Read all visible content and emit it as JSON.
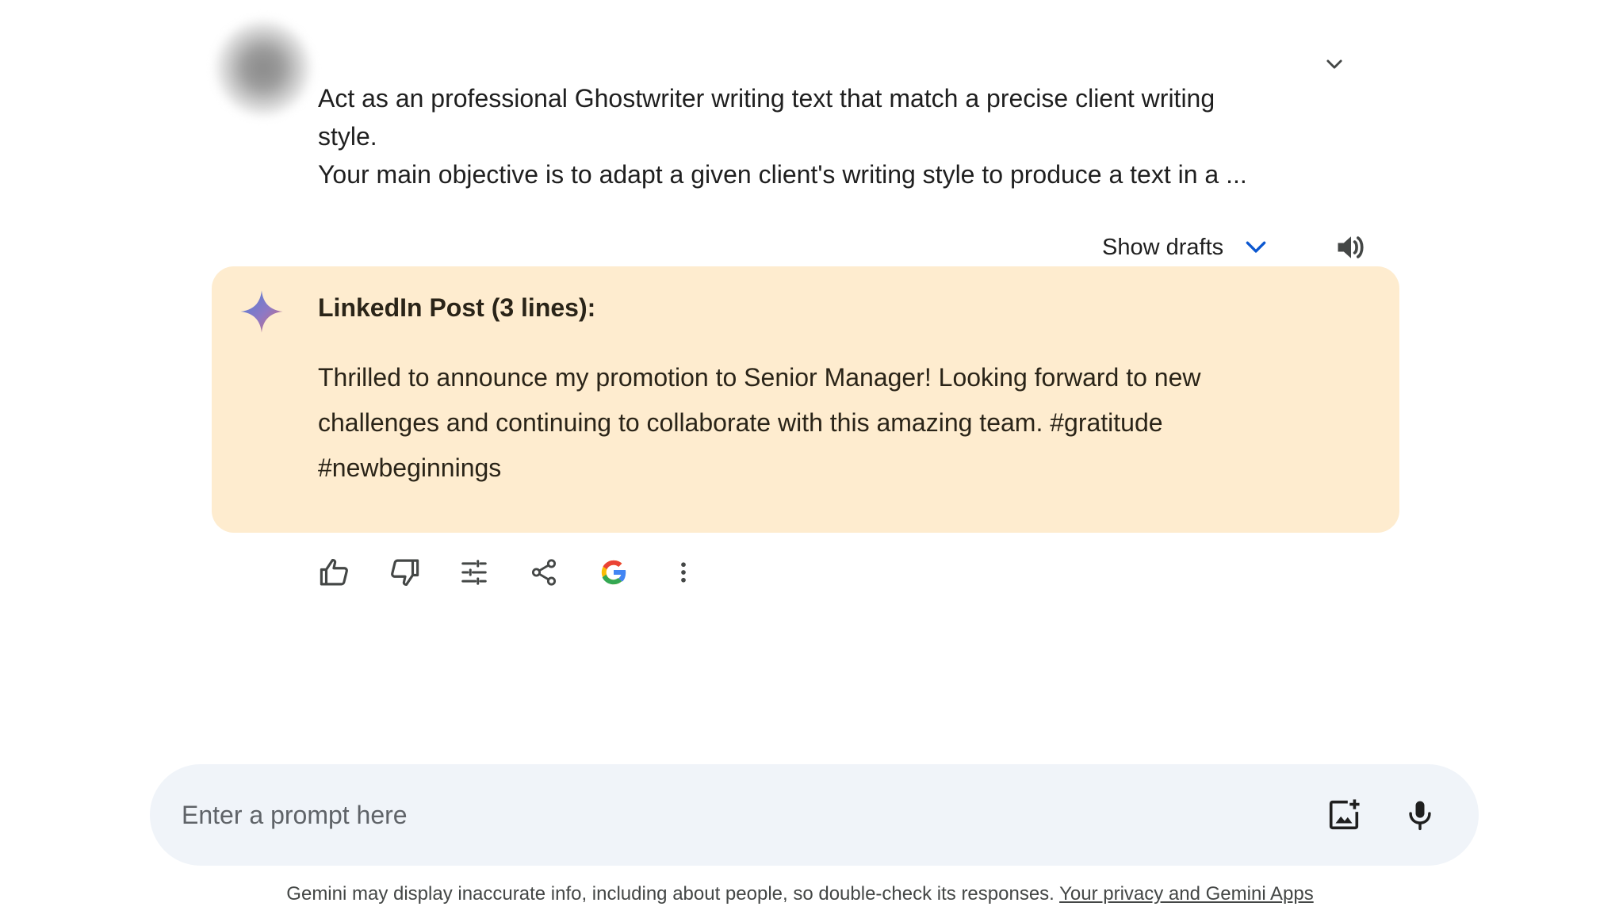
{
  "prompt": {
    "lines": [
      "Act as an professional Ghostwriter writing text that match a precise client writing",
      "style.",
      "Your main objective is to adapt a given client's writing style to produce a text in a ..."
    ],
    "collapse_icon": "chevron-down-icon"
  },
  "drafts": {
    "label": "Show drafts",
    "chevron_icon": "chevron-down-icon",
    "chevron_color": "#0b57d0",
    "speaker_icon": "volume-up-icon"
  },
  "response": {
    "background": "#feeccf",
    "heading": "LinkedIn Post (3 lines):",
    "body_lines": [
      "Thrilled to announce my promotion to Senior Manager! Looking forward to new",
      "challenges and continuing to collaborate with this amazing team. #gratitude",
      "#newbeginnings"
    ],
    "sparkle_icon": "gemini-sparkle-icon"
  },
  "actions": [
    {
      "name": "thumbs-up-icon"
    },
    {
      "name": "thumbs-down-icon"
    },
    {
      "name": "modify-response-icon"
    },
    {
      "name": "share-icon"
    },
    {
      "name": "google-check-icon"
    },
    {
      "name": "more-vertical-icon"
    }
  ],
  "input": {
    "placeholder": "Enter a prompt here",
    "value": "",
    "image_icon": "add-image-icon",
    "mic_icon": "microphone-icon",
    "background": "#f0f4f9"
  },
  "footer": {
    "disclaimer": "Gemini may display inaccurate info, including about people, so double-check its responses.",
    "link": "Your privacy and Gemini Apps"
  }
}
